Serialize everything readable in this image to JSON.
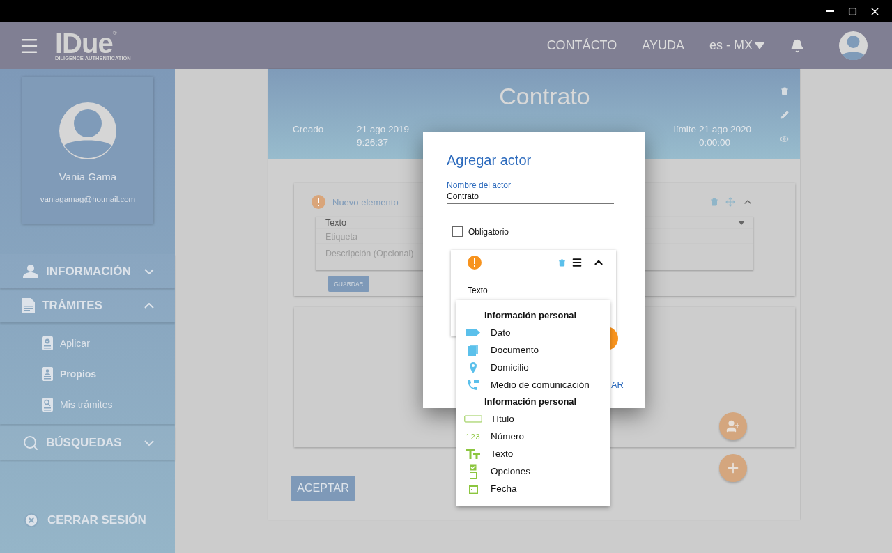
{
  "header": {
    "logo": {
      "name": "IDue",
      "mark": "®",
      "tagline": "DILIGENCE AUTHENTICATION"
    },
    "nav": [
      "CONTÁCTO",
      "AYUDA"
    ],
    "language": "es - MX"
  },
  "profile": {
    "name": "Vania Gama",
    "email": "vaniagamag@hotmail.com"
  },
  "sidebar": {
    "sections": [
      {
        "kind": "person",
        "label": "INFORMACIÓN",
        "expanded": false
      },
      {
        "kind": "document",
        "label": "TRÁMITES",
        "expanded": true,
        "children": [
          {
            "kind": "apply",
            "label": "Aplicar",
            "selected": false
          },
          {
            "kind": "own",
            "label": "Propios",
            "selected": true
          },
          {
            "kind": "find",
            "label": "Mis trámites",
            "selected": false
          }
        ]
      },
      {
        "kind": "search",
        "label": "BÚSQUEDAS",
        "expanded": false
      }
    ],
    "logout": "CERRAR SESIÓN"
  },
  "document": {
    "title": "Contrato",
    "dates": [
      {
        "label": "Creado",
        "value": [
          "21 ago 2019",
          "9:26:37"
        ]
      },
      {
        "label": "límite",
        "value": [
          "21 ago 2020",
          "0:00:00"
        ]
      }
    ]
  },
  "element_card": {
    "title": "Nuevo elemento",
    "type": "Texto",
    "label_placeholder": "Etiqueta",
    "description_placeholder": "Descripción (Opcional)",
    "save": "GUARDAR"
  },
  "accept": "ACEPTAR",
  "dialog": {
    "title": "Agregar actor",
    "field": {
      "label": "Nombre del actor",
      "value": "Contrato"
    },
    "required": {
      "label": "Obligatorio",
      "checked": false
    },
    "item": {
      "label": "Texto",
      "expanded": true
    },
    "action": "AR"
  },
  "menu": {
    "groups": [
      {
        "title": "Información personal",
        "items": [
          {
            "kind": "tag",
            "label": "Dato"
          },
          {
            "kind": "document",
            "label": "Documento"
          },
          {
            "kind": "pin",
            "label": "Domicilio"
          },
          {
            "kind": "phone",
            "label": "Medio de comunicación"
          }
        ]
      },
      {
        "title": "Información personal",
        "items": [
          {
            "kind": "title",
            "label": "Título"
          },
          {
            "kind": "glyph",
            "glyph": "123",
            "label": "Número"
          },
          {
            "kind": "text",
            "label": "Texto"
          },
          {
            "kind": "options",
            "label": "Opciones"
          },
          {
            "kind": "date",
            "label": "Fecha"
          }
        ]
      }
    ]
  }
}
